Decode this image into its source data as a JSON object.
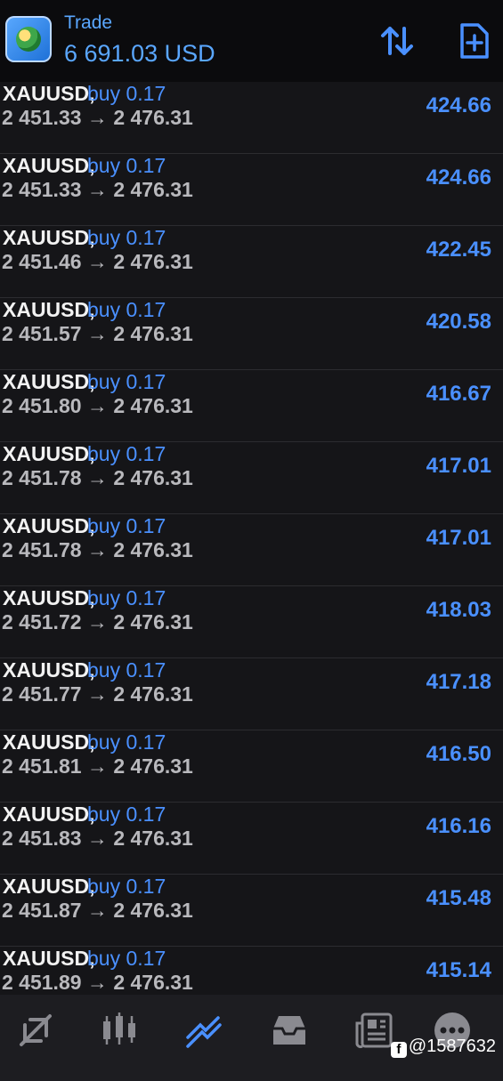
{
  "header": {
    "title": "Trade",
    "balance": "6 691.03 USD",
    "icons": [
      "sort-icon",
      "new-order-icon"
    ]
  },
  "positions": [
    {
      "symbol": "XAUUSD,",
      "side": "buy 0.17",
      "open": "2 451.33",
      "arrow": "→",
      "current": "2 476.31",
      "profit": "424.66"
    },
    {
      "symbol": "XAUUSD,",
      "side": "buy 0.17",
      "open": "2 451.33",
      "arrow": "→",
      "current": "2 476.31",
      "profit": "424.66"
    },
    {
      "symbol": "XAUUSD,",
      "side": "buy 0.17",
      "open": "2 451.46",
      "arrow": "→",
      "current": "2 476.31",
      "profit": "422.45"
    },
    {
      "symbol": "XAUUSD,",
      "side": "buy 0.17",
      "open": "2 451.57",
      "arrow": "→",
      "current": "2 476.31",
      "profit": "420.58"
    },
    {
      "symbol": "XAUUSD,",
      "side": "buy 0.17",
      "open": "2 451.80",
      "arrow": "→",
      "current": "2 476.31",
      "profit": "416.67"
    },
    {
      "symbol": "XAUUSD,",
      "side": "buy 0.17",
      "open": "2 451.78",
      "arrow": "→",
      "current": "2 476.31",
      "profit": "417.01"
    },
    {
      "symbol": "XAUUSD,",
      "side": "buy 0.17",
      "open": "2 451.78",
      "arrow": "→",
      "current": "2 476.31",
      "profit": "417.01"
    },
    {
      "symbol": "XAUUSD,",
      "side": "buy 0.17",
      "open": "2 451.72",
      "arrow": "→",
      "current": "2 476.31",
      "profit": "418.03"
    },
    {
      "symbol": "XAUUSD,",
      "side": "buy 0.17",
      "open": "2 451.77",
      "arrow": "→",
      "current": "2 476.31",
      "profit": "417.18"
    },
    {
      "symbol": "XAUUSD,",
      "side": "buy 0.17",
      "open": "2 451.81",
      "arrow": "→",
      "current": "2 476.31",
      "profit": "416.50"
    },
    {
      "symbol": "XAUUSD,",
      "side": "buy 0.17",
      "open": "2 451.83",
      "arrow": "→",
      "current": "2 476.31",
      "profit": "416.16"
    },
    {
      "symbol": "XAUUSD,",
      "side": "buy 0.17",
      "open": "2 451.87",
      "arrow": "→",
      "current": "2 476.31",
      "profit": "415.48"
    },
    {
      "symbol": "XAUUSD,",
      "side": "buy 0.17",
      "open": "2 451.89",
      "arrow": "→",
      "current": "2 476.31",
      "profit": "415.14"
    }
  ],
  "navbar": {
    "items": [
      "quotes-icon",
      "chart-icon",
      "trade-icon",
      "history-icon",
      "news-icon",
      "messages-icon"
    ],
    "active": "trade-icon"
  },
  "watermark": "@1587632",
  "colors": {
    "accent": "#4a90ff",
    "text": "#f2f2f2",
    "muted": "#b9b9bd",
    "background": "#151518"
  }
}
